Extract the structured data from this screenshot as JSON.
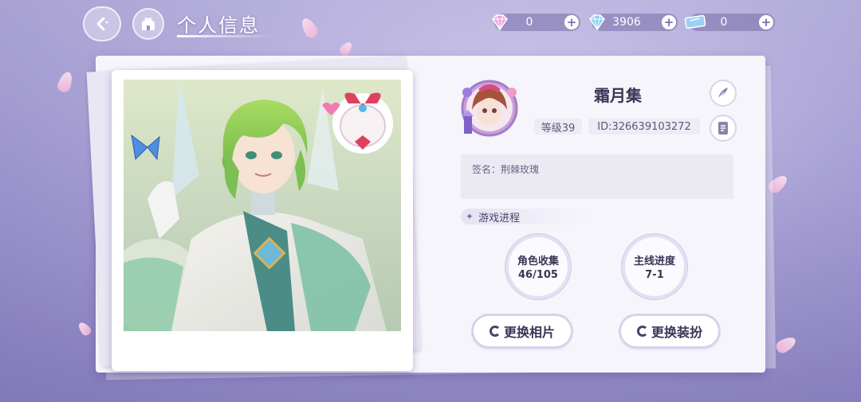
{
  "header": {
    "title": "个人信息",
    "back_icon": "back-arrow-icon",
    "home_icon": "castle-home-icon"
  },
  "currencies": [
    {
      "name": "pink-diamond",
      "icon": "pink-diamond-icon",
      "value": "0",
      "color": "#e98ad0"
    },
    {
      "name": "blue-diamond",
      "icon": "blue-diamond-icon",
      "value": "3906",
      "color": "#7fc7f2"
    },
    {
      "name": "ticket",
      "icon": "ticket-icon",
      "value": "0",
      "color": "#8fc3ee"
    }
  ],
  "profile": {
    "name": "霜月集",
    "level": "等级39",
    "id": "ID:326639103272",
    "edit_icon": "quill-edit-icon",
    "detail_icon": "document-icon"
  },
  "signature": {
    "label": "签名：荆棘玫瑰"
  },
  "progress": {
    "section_title": "游戏进程",
    "stats": [
      {
        "label": "角色收集",
        "value": "46/105"
      },
      {
        "label": "主线进度",
        "value": "7-1"
      }
    ]
  },
  "actions": {
    "change_photo": "更换相片",
    "change_outfit": "更换装扮"
  },
  "colors": {
    "accent": "#7b6fb4",
    "text_dark": "#3c3456",
    "panel": "#f6f5fb"
  }
}
